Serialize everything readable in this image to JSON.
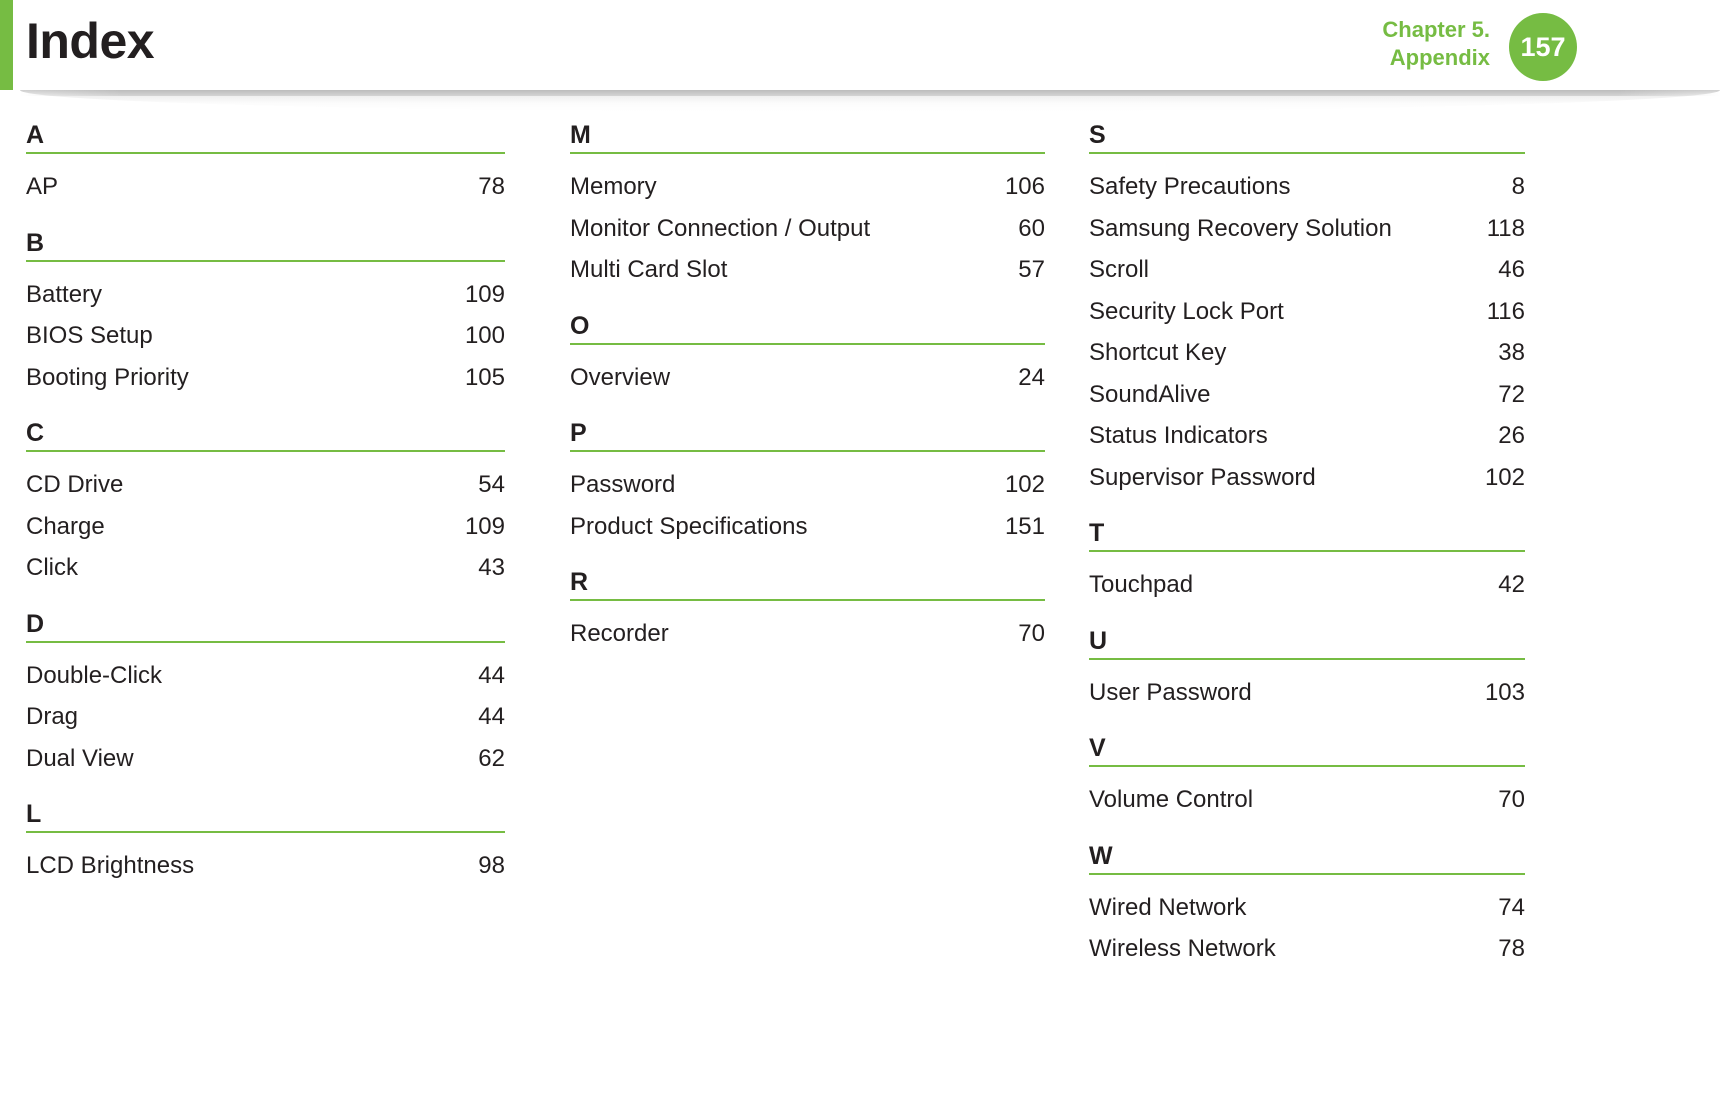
{
  "header": {
    "title": "Index",
    "chapter_line1": "Chapter 5.",
    "chapter_line2": "Appendix",
    "page_number": "157",
    "accent_color": "#76bc43",
    "text_color": "#231f20"
  },
  "columns": [
    {
      "sections": [
        {
          "letter": "A",
          "entries": [
            {
              "label": "AP",
              "page": "78"
            }
          ]
        },
        {
          "letter": "B",
          "entries": [
            {
              "label": "Battery",
              "page": "109"
            },
            {
              "label": "BIOS Setup",
              "page": "100"
            },
            {
              "label": "Booting Priority",
              "page": "105"
            }
          ]
        },
        {
          "letter": "C",
          "entries": [
            {
              "label": "CD Drive",
              "page": "54"
            },
            {
              "label": "Charge",
              "page": "109"
            },
            {
              "label": "Click",
              "page": "43"
            }
          ]
        },
        {
          "letter": "D",
          "entries": [
            {
              "label": "Double-Click",
              "page": "44"
            },
            {
              "label": "Drag",
              "page": "44"
            },
            {
              "label": "Dual View",
              "page": "62"
            }
          ]
        },
        {
          "letter": "L",
          "entries": [
            {
              "label": "LCD Brightness",
              "page": "98"
            }
          ]
        }
      ]
    },
    {
      "sections": [
        {
          "letter": "M",
          "entries": [
            {
              "label": "Memory",
              "page": "106"
            },
            {
              "label": "Monitor Connection / Output",
              "page": "60"
            },
            {
              "label": "Multi Card Slot",
              "page": "57"
            }
          ]
        },
        {
          "letter": "O",
          "entries": [
            {
              "label": "Overview",
              "page": "24"
            }
          ]
        },
        {
          "letter": "P",
          "entries": [
            {
              "label": "Password",
              "page": "102"
            },
            {
              "label": "Product Specifications",
              "page": "151"
            }
          ]
        },
        {
          "letter": "R",
          "entries": [
            {
              "label": "Recorder",
              "page": "70"
            }
          ]
        }
      ]
    },
    {
      "sections": [
        {
          "letter": "S",
          "entries": [
            {
              "label": "Safety Precautions",
              "page": "8"
            },
            {
              "label": "Samsung Recovery Solution",
              "page": "118"
            },
            {
              "label": "Scroll",
              "page": "46"
            },
            {
              "label": "Security Lock Port",
              "page": "116"
            },
            {
              "label": "Shortcut Key",
              "page": "38"
            },
            {
              "label": "SoundAlive",
              "page": "72"
            },
            {
              "label": "Status Indicators",
              "page": "26"
            },
            {
              "label": "Supervisor Password",
              "page": "102"
            }
          ]
        },
        {
          "letter": "T",
          "entries": [
            {
              "label": "Touchpad",
              "page": "42"
            }
          ]
        },
        {
          "letter": "U",
          "entries": [
            {
              "label": "User Password",
              "page": "103"
            }
          ]
        },
        {
          "letter": "V",
          "entries": [
            {
              "label": "Volume Control",
              "page": "70"
            }
          ]
        },
        {
          "letter": "W",
          "entries": [
            {
              "label": "Wired Network",
              "page": "74"
            },
            {
              "label": "Wireless Network",
              "page": "78"
            }
          ]
        }
      ]
    }
  ]
}
